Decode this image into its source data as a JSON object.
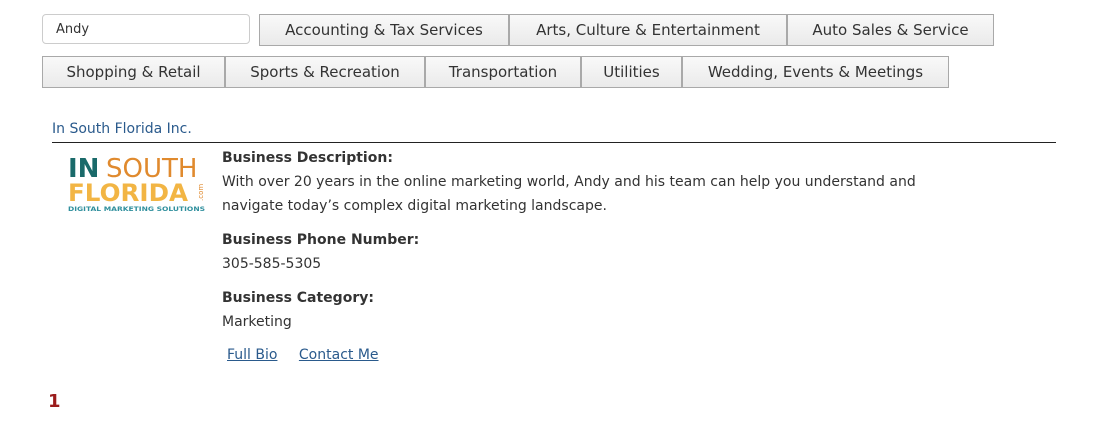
{
  "search": {
    "value": "Andy"
  },
  "categories": {
    "row1": [
      "Accounting & Tax Services",
      "Arts, Culture & Entertainment",
      "Auto Sales & Service"
    ],
    "row2": [
      "Shopping & Retail",
      "Sports & Recreation",
      "Transportation",
      "Utilities",
      "Wedding, Events & Meetings"
    ]
  },
  "listing": {
    "name": "In South Florida Inc.",
    "logo": {
      "line1_a": "IN",
      "line1_b": "SOUTH",
      "line2": "FLORIDA",
      "dotcom": ".com",
      "tagline": "DIGITAL MARKETING SOLUTIONS",
      "colors": {
        "teal": "#1a6a6a",
        "orange": "#e08a2e",
        "gold": "#f2b544",
        "tagline": "#2f8f9d"
      }
    },
    "description_label": "Business Description:",
    "description_line1": "With over 20 years in the online marketing world, Andy and his team can help you understand and",
    "description_line2": "navigate today’s complex digital marketing landscape.",
    "phone_label": "Business Phone Number:",
    "phone": "305-585-5305",
    "category_label": "Business Category:",
    "category": "Marketing",
    "links": {
      "bio": "Full Bio",
      "contact": "Contact Me"
    }
  },
  "pagination": {
    "current": "1"
  },
  "colors": {
    "link": "#2a5a8c",
    "page_number": "#9b1c1c"
  }
}
